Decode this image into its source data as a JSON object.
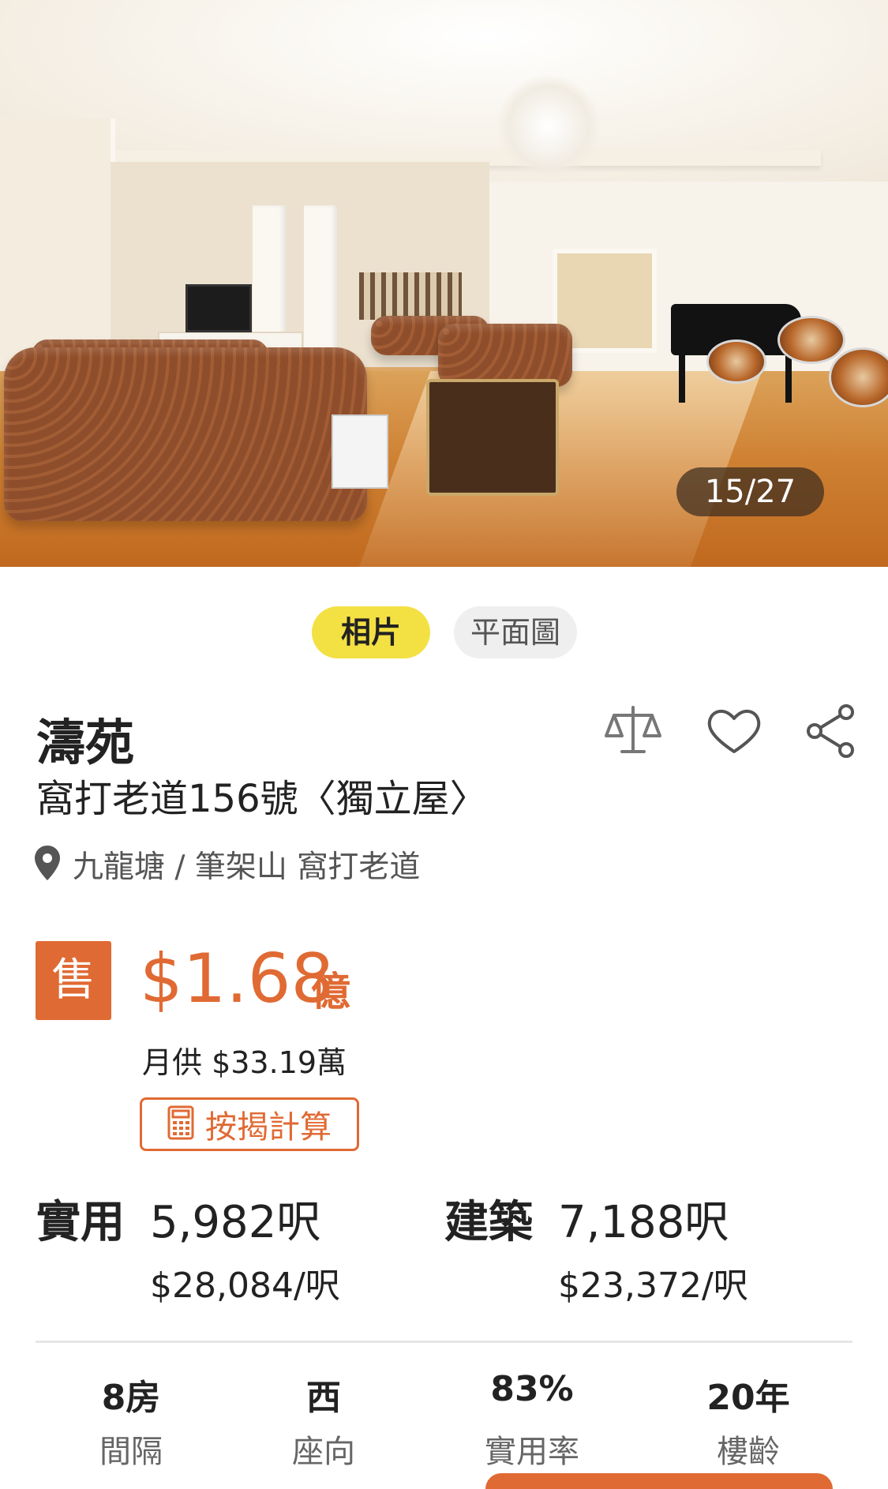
{
  "gallery": {
    "counter": "15/27",
    "tabs": [
      {
        "label": "相片",
        "active": true
      },
      {
        "label": "平面圖",
        "active": false
      }
    ]
  },
  "listing": {
    "name": "濤苑",
    "address": "窩打老道156號〈獨立屋〉",
    "location": "九龍塘 / 筆架山 窩打老道",
    "actions": [
      "compare-icon",
      "heart-icon",
      "share-icon"
    ]
  },
  "price": {
    "badge": "售",
    "amount": "$1.68",
    "unit": "億",
    "monthly": "月供 $33.19萬",
    "calculator_label": "按揭計算"
  },
  "area": {
    "saleable_label": "實用",
    "saleable_value": "5,982呎",
    "saleable_ppf": "$28,084/呎",
    "gross_label": "建築",
    "gross_value": "7,188呎",
    "gross_ppf": "$23,372/呎"
  },
  "stats": [
    {
      "value": "8房",
      "label": "間隔"
    },
    {
      "value": "西",
      "label": "座向"
    },
    {
      "value": "83%",
      "label": "實用率"
    },
    {
      "value": "20年",
      "label": "樓齡"
    }
  ],
  "colors": {
    "accent": "#e06a33",
    "tab_active": "#f3e043",
    "tab_inactive": "#efefef"
  }
}
